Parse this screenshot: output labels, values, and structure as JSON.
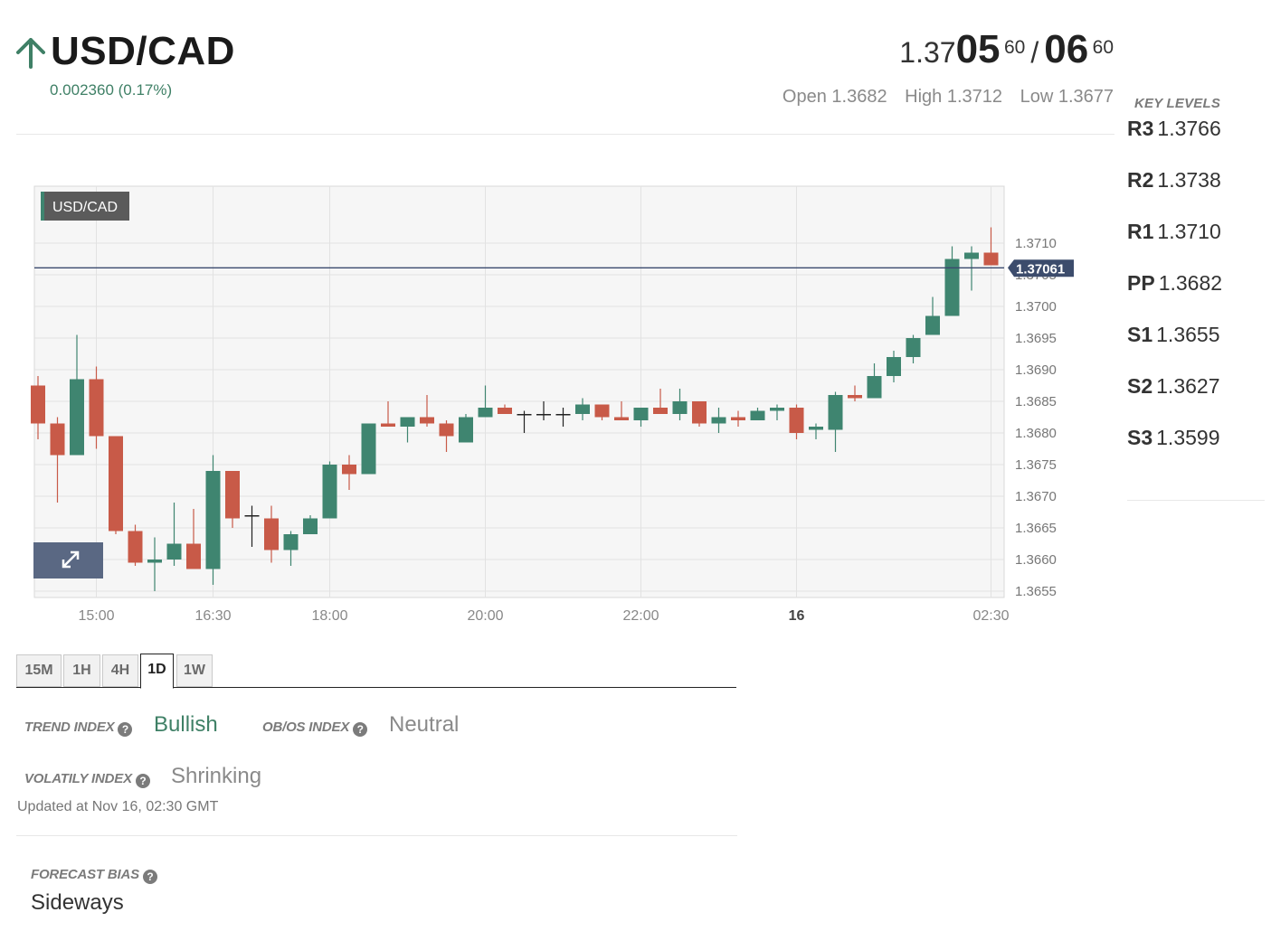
{
  "header": {
    "pair": "USD/CAD",
    "change": "0.002360 (0.17%)",
    "direction_icon": "up-arrow-icon",
    "up_color": "#3f8066"
  },
  "quote": {
    "bid_base": "1.37",
    "bid_big": "05",
    "bid_sup": "60",
    "separator": "/",
    "ask_big": "06",
    "ask_sup": "60"
  },
  "ohl": {
    "open": "Open 1.3682",
    "high": "High 1.3712",
    "low": "Low 1.3677"
  },
  "key_levels": {
    "title": "KEY LEVELS",
    "items": [
      {
        "label": "R3",
        "value": "1.3766"
      },
      {
        "label": "R2",
        "value": "1.3738"
      },
      {
        "label": "R1",
        "value": "1.3710"
      },
      {
        "label": "PP",
        "value": "1.3682"
      },
      {
        "label": "S1",
        "value": "1.3655"
      },
      {
        "label": "S2",
        "value": "1.3627"
      },
      {
        "label": "S3",
        "value": "1.3599"
      }
    ]
  },
  "chart_data": {
    "type": "candlestick",
    "legend_label": "USD/CAD",
    "expand_icon": "expand-icon",
    "current_price": 1.37061,
    "current_price_label": "1.37061",
    "ylim": [
      1.3654,
      1.3719
    ],
    "y_ticks": [
      "1.3710",
      "1.3705",
      "1.3700",
      "1.3695",
      "1.3690",
      "1.3685",
      "1.3680",
      "1.3675",
      "1.3670",
      "1.3665",
      "1.3660",
      "1.3655"
    ],
    "x_ticks": [
      {
        "label": "15:00",
        "index": 3,
        "bold": false
      },
      {
        "label": "16:30",
        "index": 9,
        "bold": false
      },
      {
        "label": "18:00",
        "index": 15,
        "bold": false
      },
      {
        "label": "20:00",
        "index": 23,
        "bold": false
      },
      {
        "label": "22:00",
        "index": 31,
        "bold": false
      },
      {
        "label": "16",
        "index": 39,
        "bold": true
      },
      {
        "label": "02:30",
        "index": 49,
        "bold": false
      }
    ],
    "up_color": "#3f8570",
    "down_color": "#c85a48",
    "candles": [
      {
        "o": 1.36875,
        "h": 1.3689,
        "l": 1.3679,
        "c": 1.36815
      },
      {
        "o": 1.36815,
        "h": 1.36825,
        "l": 1.3669,
        "c": 1.36765
      },
      {
        "o": 1.36765,
        "h": 1.36955,
        "l": 1.36765,
        "c": 1.36885
      },
      {
        "o": 1.36885,
        "h": 1.36905,
        "l": 1.36775,
        "c": 1.36795
      },
      {
        "o": 1.36795,
        "h": 1.36795,
        "l": 1.3664,
        "c": 1.36645
      },
      {
        "o": 1.36645,
        "h": 1.36655,
        "l": 1.3659,
        "c": 1.36595
      },
      {
        "o": 1.36595,
        "h": 1.36635,
        "l": 1.3655,
        "c": 1.366
      },
      {
        "o": 1.366,
        "h": 1.3669,
        "l": 1.3659,
        "c": 1.36625
      },
      {
        "o": 1.36625,
        "h": 1.3668,
        "l": 1.36585,
        "c": 1.36585
      },
      {
        "o": 1.36585,
        "h": 1.36765,
        "l": 1.3656,
        "c": 1.3674
      },
      {
        "o": 1.3674,
        "h": 1.3674,
        "l": 1.3665,
        "c": 1.36665
      },
      {
        "o": 1.3667,
        "h": 1.36685,
        "l": 1.3662,
        "c": 1.3667
      },
      {
        "o": 1.36665,
        "h": 1.36685,
        "l": 1.36595,
        "c": 1.36615
      },
      {
        "o": 1.36615,
        "h": 1.36645,
        "l": 1.3659,
        "c": 1.3664
      },
      {
        "o": 1.3664,
        "h": 1.3667,
        "l": 1.3664,
        "c": 1.36665
      },
      {
        "o": 1.36665,
        "h": 1.36755,
        "l": 1.36665,
        "c": 1.3675
      },
      {
        "o": 1.3675,
        "h": 1.36765,
        "l": 1.3671,
        "c": 1.36735
      },
      {
        "o": 1.36735,
        "h": 1.36815,
        "l": 1.36735,
        "c": 1.36815
      },
      {
        "o": 1.36815,
        "h": 1.3685,
        "l": 1.3681,
        "c": 1.3681
      },
      {
        "o": 1.3681,
        "h": 1.36825,
        "l": 1.36785,
        "c": 1.36825
      },
      {
        "o": 1.36825,
        "h": 1.3686,
        "l": 1.3681,
        "c": 1.36815
      },
      {
        "o": 1.36815,
        "h": 1.3682,
        "l": 1.3677,
        "c": 1.36795
      },
      {
        "o": 1.36785,
        "h": 1.3683,
        "l": 1.36785,
        "c": 1.36825
      },
      {
        "o": 1.36825,
        "h": 1.36875,
        "l": 1.36825,
        "c": 1.3684
      },
      {
        "o": 1.3684,
        "h": 1.36845,
        "l": 1.3683,
        "c": 1.3683
      },
      {
        "o": 1.3683,
        "h": 1.36835,
        "l": 1.368,
        "c": 1.3683
      },
      {
        "o": 1.3683,
        "h": 1.3685,
        "l": 1.3682,
        "c": 1.3683
      },
      {
        "o": 1.3683,
        "h": 1.3684,
        "l": 1.3681,
        "c": 1.3683
      },
      {
        "o": 1.3683,
        "h": 1.36855,
        "l": 1.3682,
        "c": 1.36845
      },
      {
        "o": 1.36845,
        "h": 1.36845,
        "l": 1.3682,
        "c": 1.36825
      },
      {
        "o": 1.36825,
        "h": 1.3685,
        "l": 1.3682,
        "c": 1.3682
      },
      {
        "o": 1.3682,
        "h": 1.3684,
        "l": 1.3681,
        "c": 1.3684
      },
      {
        "o": 1.3684,
        "h": 1.3687,
        "l": 1.3683,
        "c": 1.3683
      },
      {
        "o": 1.3683,
        "h": 1.3687,
        "l": 1.3682,
        "c": 1.3685
      },
      {
        "o": 1.3685,
        "h": 1.3684,
        "l": 1.3681,
        "c": 1.36815
      },
      {
        "o": 1.36815,
        "h": 1.3684,
        "l": 1.368,
        "c": 1.36825
      },
      {
        "o": 1.36825,
        "h": 1.36835,
        "l": 1.3681,
        "c": 1.3682
      },
      {
        "o": 1.3682,
        "h": 1.3684,
        "l": 1.3682,
        "c": 1.36835
      },
      {
        "o": 1.36835,
        "h": 1.36845,
        "l": 1.3682,
        "c": 1.3684
      },
      {
        "o": 1.3684,
        "h": 1.36845,
        "l": 1.3679,
        "c": 1.368
      },
      {
        "o": 1.36805,
        "h": 1.36815,
        "l": 1.3679,
        "c": 1.3681
      },
      {
        "o": 1.36805,
        "h": 1.36865,
        "l": 1.3677,
        "c": 1.3686
      },
      {
        "o": 1.3686,
        "h": 1.36875,
        "l": 1.3685,
        "c": 1.36855
      },
      {
        "o": 1.36855,
        "h": 1.3691,
        "l": 1.36855,
        "c": 1.3689
      },
      {
        "o": 1.3689,
        "h": 1.3693,
        "l": 1.3688,
        "c": 1.3692
      },
      {
        "o": 1.3692,
        "h": 1.36955,
        "l": 1.3691,
        "c": 1.3695
      },
      {
        "o": 1.36955,
        "h": 1.37015,
        "l": 1.36955,
        "c": 1.36985
      },
      {
        "o": 1.36985,
        "h": 1.37095,
        "l": 1.36985,
        "c": 1.37075
      },
      {
        "o": 1.37075,
        "h": 1.37095,
        "l": 1.37025,
        "c": 1.37085
      },
      {
        "o": 1.37085,
        "h": 1.37125,
        "l": 1.37065,
        "c": 1.37065
      }
    ]
  },
  "timeframes": {
    "tabs": [
      {
        "label": "15M",
        "active": false
      },
      {
        "label": "1H",
        "active": false
      },
      {
        "label": "4H",
        "active": false
      },
      {
        "label": "1D",
        "active": true
      },
      {
        "label": "1W",
        "active": false
      }
    ]
  },
  "indices": {
    "trend_label": "TREND INDEX",
    "trend_value": "Bullish",
    "trend_color": "#3f8066",
    "obos_label": "OB/OS INDEX",
    "obos_value": "Neutral",
    "obos_color": "#8a8a8a",
    "volatility_label": "VOLATILY INDEX",
    "volatility_value": "Shrinking",
    "volatility_color": "#8a8a8a",
    "help_icon": "question-circle-icon",
    "help_glyph": "?"
  },
  "updated": "Updated at Nov 16, 02:30 GMT",
  "forecast": {
    "label": "FORECAST BIAS",
    "value": "Sideways"
  }
}
